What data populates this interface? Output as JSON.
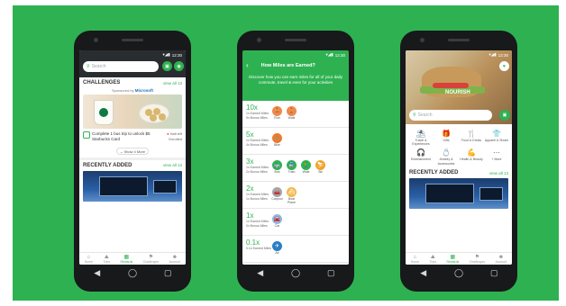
{
  "colors": {
    "background": "#2eb251",
    "accent": "#2eb251",
    "phone": "#17191b"
  },
  "status": {
    "time": "12:30"
  },
  "android_nav": {
    "back": "◀",
    "home": "◯",
    "recents": "▢"
  },
  "phone1": {
    "search_placeholder": "Search",
    "challenges": {
      "title": "CHALLENGES",
      "view_all": "view all 13",
      "sponsored_by": "Sponsored by",
      "sponsor_name": "Microsoft"
    },
    "challenge": {
      "text": "Complete 1 bus trip to unlock $5 Starbucks Card",
      "days_left": "Hall left",
      "status": "Enrolled"
    },
    "show_more": "Show 4 More",
    "recently_added": {
      "title": "RECENTLY ADDED",
      "view_all": "view all 13"
    },
    "tabs": [
      {
        "label": "Home",
        "icon": "home-icon"
      },
      {
        "label": "Trips",
        "icon": "trips-icon"
      },
      {
        "label": "Rewards",
        "icon": "rewards-icon"
      },
      {
        "label": "Challenges",
        "icon": "challenges-icon"
      },
      {
        "label": "Account",
        "icon": "account-icon"
      }
    ]
  },
  "phone2": {
    "title": "How Miles are Earned?",
    "subtitle": "Discover how you can earn miles for all of your daily commute, travel & even for your activities",
    "tiers": [
      {
        "mult": "10x",
        "earned": "1x Earned Miles",
        "bonus": "9x Bonus Miles",
        "modes": [
          {
            "label": "Run",
            "color": "#f0894a",
            "glyph": "🏃"
          },
          {
            "label": "Walk",
            "color": "#f0894a",
            "glyph": "🚶"
          }
        ]
      },
      {
        "mult": "5x",
        "earned": "1x Earned Miles",
        "bonus": "4x Bonus Miles",
        "modes": [
          {
            "label": "Bike",
            "color": "#ef7a2b",
            "glyph": "🚲"
          }
        ]
      },
      {
        "mult": "3x",
        "earned": "1x Earned Miles",
        "bonus": "2x Bonus Miles",
        "modes": [
          {
            "label": "Bus",
            "color": "#2eb251",
            "glyph": "🚌"
          },
          {
            "label": "Train",
            "color": "#2eb251",
            "glyph": "🚆"
          },
          {
            "label": "Walk",
            "color": "#2eb251",
            "glyph": "🚶"
          },
          {
            "label": "Ski",
            "color": "#f0a52b",
            "glyph": "⛷"
          }
        ]
      },
      {
        "mult": "2x",
        "earned": "1x Earned Miles",
        "bonus": "1x Bonus Miles",
        "modes": [
          {
            "label": "Carpool",
            "color": "#a5a5a5",
            "glyph": "🚗"
          },
          {
            "label": "Boat Plane",
            "color": "#f2b84a",
            "glyph": "⛴"
          }
        ]
      },
      {
        "mult": "1x",
        "earned": "1x Earned Miles",
        "bonus": "0x Bonus Miles",
        "modes": [
          {
            "label": "Car",
            "color": "#8fb8e0",
            "glyph": "🚘"
          }
        ]
      },
      {
        "mult": "0.1x",
        "earned": "0.1x Earned Miles",
        "bonus": "",
        "modes": [
          {
            "label": "Air",
            "color": "#2a7ec4",
            "glyph": "✈"
          }
        ]
      }
    ]
  },
  "phone3": {
    "hero_label": "NOURISH",
    "search_placeholder": "Search",
    "categories": [
      {
        "label": "Travel & Experiences",
        "glyph": "⛱"
      },
      {
        "label": "Gifts",
        "glyph": "🎁"
      },
      {
        "label": "Food & Drinks",
        "glyph": "🍴"
      },
      {
        "label": "Apparel & Shoes",
        "glyph": "👕"
      },
      {
        "label": "Entertainment",
        "glyph": "🎧"
      },
      {
        "label": "Jewelry & Accessories",
        "glyph": "💍"
      },
      {
        "label": "Health & Beauty",
        "glyph": "💪"
      },
      {
        "label": "+ More",
        "glyph": "⋯"
      }
    ],
    "recently_added": {
      "title": "RECENTLY ADDED",
      "view_all": "view all 13"
    },
    "tabs": [
      {
        "label": "Home",
        "icon": "home-icon"
      },
      {
        "label": "Trips",
        "icon": "trips-icon"
      },
      {
        "label": "Rewards",
        "icon": "rewards-icon"
      },
      {
        "label": "Challenges",
        "icon": "challenges-icon"
      },
      {
        "label": "Account",
        "icon": "account-icon"
      }
    ]
  }
}
